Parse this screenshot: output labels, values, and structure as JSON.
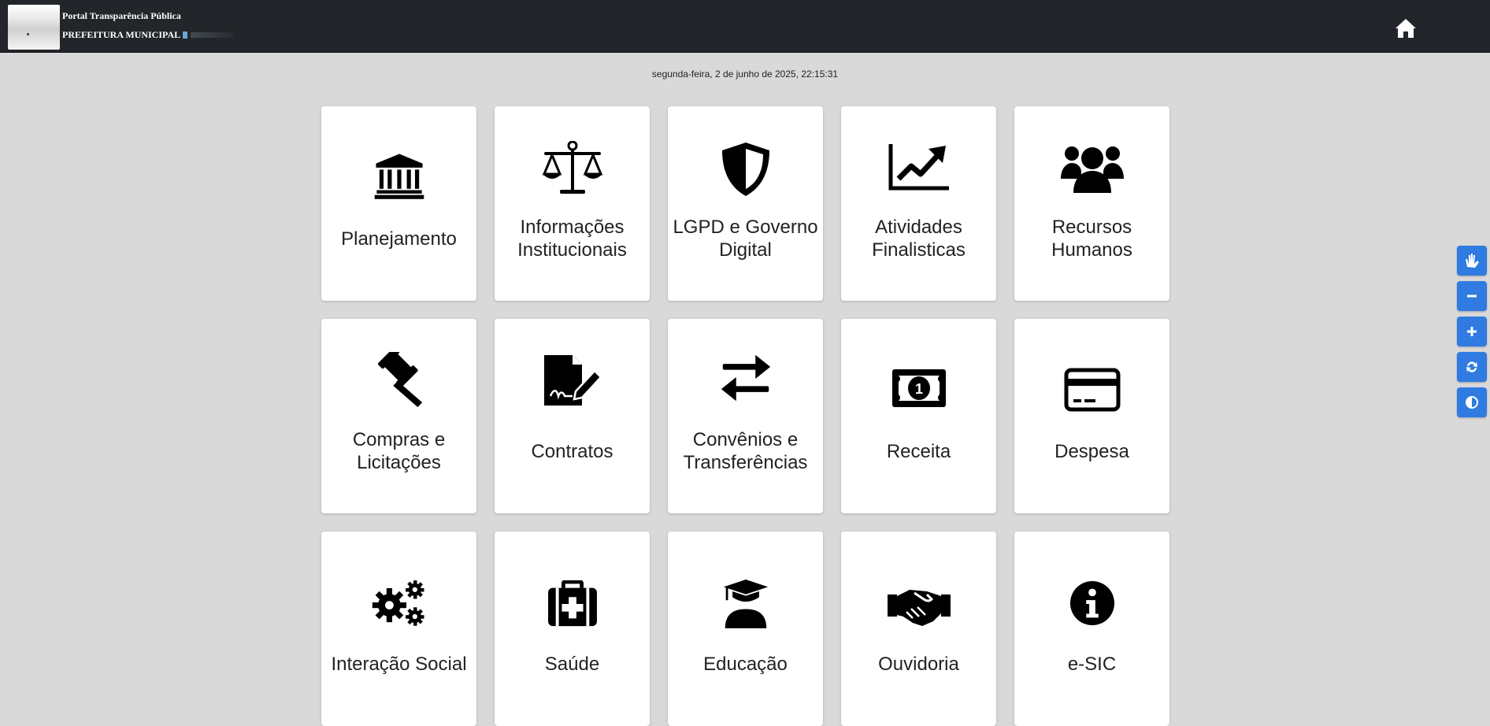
{
  "header": {
    "title": "Portal Transparência Pública",
    "subtitle": "PREFEITURA MUNICIPAL"
  },
  "datetime": "segunda-feira, 2 de junho de 2025, 22:15:31",
  "cards": [
    {
      "label": "Planejamento",
      "icon": "bank-icon"
    },
    {
      "label": "Informações Institucionais",
      "icon": "scale-icon"
    },
    {
      "label": "LGPD e Governo Digital",
      "icon": "shield-icon"
    },
    {
      "label": "Atividades Finalisticas",
      "icon": "chart-line-icon"
    },
    {
      "label": "Recursos Humanos",
      "icon": "users-icon"
    },
    {
      "label": "Compras e Licitações",
      "icon": "gavel-icon"
    },
    {
      "label": "Contratos",
      "icon": "file-signature-icon"
    },
    {
      "label": "Convênios e Transferências",
      "icon": "exchange-arrows-icon"
    },
    {
      "label": "Receita",
      "icon": "money-bill-icon"
    },
    {
      "label": "Despesa",
      "icon": "credit-card-icon"
    },
    {
      "label": "Interação Social",
      "icon": "cogs-icon"
    },
    {
      "label": "Saúde",
      "icon": "medkit-icon"
    },
    {
      "label": "Educação",
      "icon": "graduate-icon"
    },
    {
      "label": "Ouvidoria",
      "icon": "handshake-icon"
    },
    {
      "label": "e-SIC",
      "icon": "info-circle-icon"
    }
  ],
  "accessibility": [
    {
      "name": "sign-language-icon",
      "symbol": "✋"
    },
    {
      "name": "font-decrease-icon",
      "symbol": "−"
    },
    {
      "name": "font-increase-icon",
      "symbol": "+"
    },
    {
      "name": "reset-icon",
      "symbol": "↻"
    },
    {
      "name": "contrast-icon",
      "symbol": "◐"
    }
  ],
  "colors": {
    "topbar": "#222529",
    "background": "#d9d9d9",
    "accessibility_button": "#2f7be2"
  }
}
